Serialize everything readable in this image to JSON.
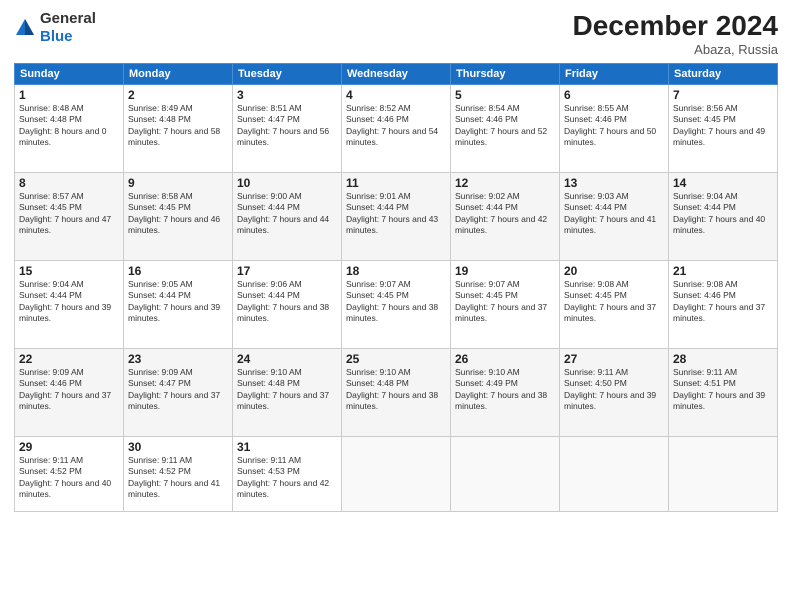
{
  "header": {
    "logo_general": "General",
    "logo_blue": "Blue",
    "month_year": "December 2024",
    "location": "Abaza, Russia"
  },
  "days_of_week": [
    "Sunday",
    "Monday",
    "Tuesday",
    "Wednesday",
    "Thursday",
    "Friday",
    "Saturday"
  ],
  "weeks": [
    [
      {
        "day": "1",
        "sunrise": "8:48 AM",
        "sunset": "4:48 PM",
        "daylight": "8 hours and 0 minutes."
      },
      {
        "day": "2",
        "sunrise": "8:49 AM",
        "sunset": "4:48 PM",
        "daylight": "7 hours and 58 minutes."
      },
      {
        "day": "3",
        "sunrise": "8:51 AM",
        "sunset": "4:47 PM",
        "daylight": "7 hours and 56 minutes."
      },
      {
        "day": "4",
        "sunrise": "8:52 AM",
        "sunset": "4:46 PM",
        "daylight": "7 hours and 54 minutes."
      },
      {
        "day": "5",
        "sunrise": "8:54 AM",
        "sunset": "4:46 PM",
        "daylight": "7 hours and 52 minutes."
      },
      {
        "day": "6",
        "sunrise": "8:55 AM",
        "sunset": "4:46 PM",
        "daylight": "7 hours and 50 minutes."
      },
      {
        "day": "7",
        "sunrise": "8:56 AM",
        "sunset": "4:45 PM",
        "daylight": "7 hours and 49 minutes."
      }
    ],
    [
      {
        "day": "8",
        "sunrise": "8:57 AM",
        "sunset": "4:45 PM",
        "daylight": "7 hours and 47 minutes."
      },
      {
        "day": "9",
        "sunrise": "8:58 AM",
        "sunset": "4:45 PM",
        "daylight": "7 hours and 46 minutes."
      },
      {
        "day": "10",
        "sunrise": "9:00 AM",
        "sunset": "4:44 PM",
        "daylight": "7 hours and 44 minutes."
      },
      {
        "day": "11",
        "sunrise": "9:01 AM",
        "sunset": "4:44 PM",
        "daylight": "7 hours and 43 minutes."
      },
      {
        "day": "12",
        "sunrise": "9:02 AM",
        "sunset": "4:44 PM",
        "daylight": "7 hours and 42 minutes."
      },
      {
        "day": "13",
        "sunrise": "9:03 AM",
        "sunset": "4:44 PM",
        "daylight": "7 hours and 41 minutes."
      },
      {
        "day": "14",
        "sunrise": "9:04 AM",
        "sunset": "4:44 PM",
        "daylight": "7 hours and 40 minutes."
      }
    ],
    [
      {
        "day": "15",
        "sunrise": "9:04 AM",
        "sunset": "4:44 PM",
        "daylight": "7 hours and 39 minutes."
      },
      {
        "day": "16",
        "sunrise": "9:05 AM",
        "sunset": "4:44 PM",
        "daylight": "7 hours and 39 minutes."
      },
      {
        "day": "17",
        "sunrise": "9:06 AM",
        "sunset": "4:44 PM",
        "daylight": "7 hours and 38 minutes."
      },
      {
        "day": "18",
        "sunrise": "9:07 AM",
        "sunset": "4:45 PM",
        "daylight": "7 hours and 38 minutes."
      },
      {
        "day": "19",
        "sunrise": "9:07 AM",
        "sunset": "4:45 PM",
        "daylight": "7 hours and 37 minutes."
      },
      {
        "day": "20",
        "sunrise": "9:08 AM",
        "sunset": "4:45 PM",
        "daylight": "7 hours and 37 minutes."
      },
      {
        "day": "21",
        "sunrise": "9:08 AM",
        "sunset": "4:46 PM",
        "daylight": "7 hours and 37 minutes."
      }
    ],
    [
      {
        "day": "22",
        "sunrise": "9:09 AM",
        "sunset": "4:46 PM",
        "daylight": "7 hours and 37 minutes."
      },
      {
        "day": "23",
        "sunrise": "9:09 AM",
        "sunset": "4:47 PM",
        "daylight": "7 hours and 37 minutes."
      },
      {
        "day": "24",
        "sunrise": "9:10 AM",
        "sunset": "4:48 PM",
        "daylight": "7 hours and 37 minutes."
      },
      {
        "day": "25",
        "sunrise": "9:10 AM",
        "sunset": "4:48 PM",
        "daylight": "7 hours and 38 minutes."
      },
      {
        "day": "26",
        "sunrise": "9:10 AM",
        "sunset": "4:49 PM",
        "daylight": "7 hours and 38 minutes."
      },
      {
        "day": "27",
        "sunrise": "9:11 AM",
        "sunset": "4:50 PM",
        "daylight": "7 hours and 39 minutes."
      },
      {
        "day": "28",
        "sunrise": "9:11 AM",
        "sunset": "4:51 PM",
        "daylight": "7 hours and 39 minutes."
      }
    ],
    [
      {
        "day": "29",
        "sunrise": "9:11 AM",
        "sunset": "4:52 PM",
        "daylight": "7 hours and 40 minutes."
      },
      {
        "day": "30",
        "sunrise": "9:11 AM",
        "sunset": "4:52 PM",
        "daylight": "7 hours and 41 minutes."
      },
      {
        "day": "31",
        "sunrise": "9:11 AM",
        "sunset": "4:53 PM",
        "daylight": "7 hours and 42 minutes."
      },
      null,
      null,
      null,
      null
    ]
  ]
}
